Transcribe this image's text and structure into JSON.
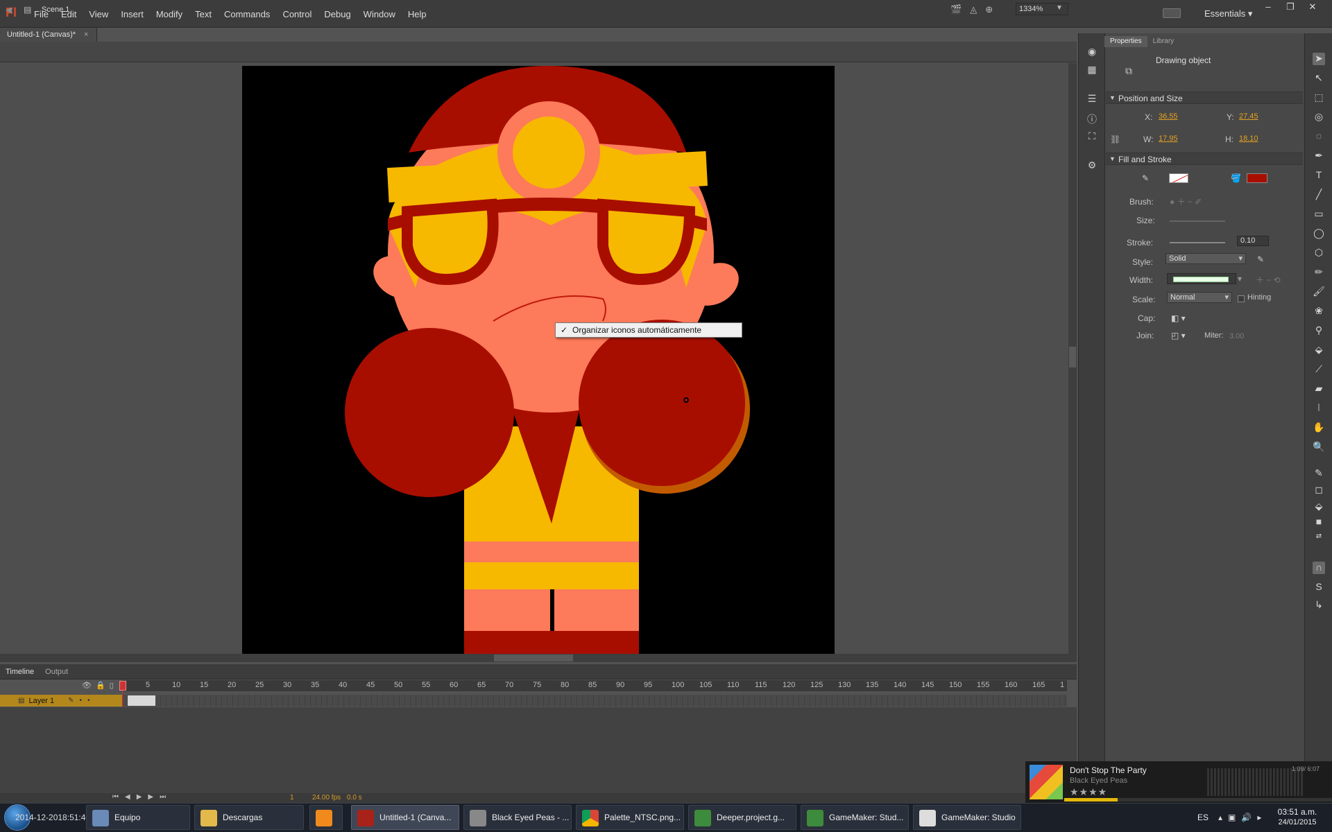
{
  "app": {
    "logo": "Fl",
    "workspace": "Essentials"
  },
  "menubar": {
    "items": [
      "File",
      "Edit",
      "View",
      "Insert",
      "Modify",
      "Text",
      "Commands",
      "Control",
      "Debug",
      "Window",
      "Help"
    ]
  },
  "window_controls": {
    "minimize": "–",
    "restore": "❐",
    "close": "✕"
  },
  "document": {
    "tab_title": "Untitled-1 (Canvas)*",
    "close": "×"
  },
  "edit_bar": {
    "scene": "Scene 1",
    "zoom": "1334%"
  },
  "context_menu": {
    "check": "✓",
    "item": "Organizar iconos automáticamente",
    "checked": true
  },
  "timeline": {
    "tabs": [
      "Timeline",
      "Output"
    ],
    "active_tab": "Timeline",
    "ruler": [
      "5",
      "10",
      "15",
      "20",
      "25",
      "30",
      "35",
      "40",
      "45",
      "50",
      "55",
      "60",
      "65",
      "70",
      "75",
      "80",
      "85",
      "90",
      "95",
      "100",
      "105",
      "110",
      "115",
      "120",
      "125",
      "130",
      "135",
      "140",
      "145",
      "150",
      "155",
      "160",
      "165",
      "1"
    ],
    "layer_name": "Layer 1",
    "current_frame": "1",
    "fps": "24.00 fps",
    "time": "0.0 s"
  },
  "properties": {
    "tabs": [
      "Properties",
      "Library"
    ],
    "active_tab": "Properties",
    "object_type": "Drawing object",
    "position_section": "Position and Size",
    "x_label": "X:",
    "x": "36.55",
    "y_label": "Y:",
    "y": "27.45",
    "w_label": "W:",
    "w": "17.95",
    "h_label": "H:",
    "h": "18.10",
    "fill_section": "Fill and Stroke",
    "fill_color": "#a80e00",
    "brush_label": "Brush:",
    "size_label": "Size:",
    "stroke_label": "Stroke:",
    "stroke": "0.10",
    "style_label": "Style:",
    "style": "Solid",
    "width_label": "Width:",
    "scale_label": "Scale:",
    "scale": "Normal",
    "hinting_label": "Hinting",
    "cap_label": "Cap:",
    "join_label": "Join:",
    "miter_label": "Miter:",
    "miter": "3.00"
  },
  "music": {
    "title": "Don't Stop The Party",
    "artist": "Black Eyed Peas",
    "stars": "★★★★",
    "time": "1:09/ 6:07",
    "progress": 0.2
  },
  "taskbar": {
    "start_tip": "2014-12-2018:51:40.ip",
    "tasks": [
      "Equipo",
      "Descargas",
      "",
      "Untitled-1 (Canva...",
      "Black Eyed Peas - ...",
      "Palette_NTSC.png...",
      "Deeper.project.g...",
      "GameMaker: Stud...",
      "GameMaker: Studio"
    ],
    "lang": "ES",
    "time": "03:51 a.m.",
    "date": "24/01/2015"
  },
  "colors": {
    "stage_bg": "#000000",
    "skin": "#fd7a5a",
    "red": "#a80e00",
    "yellow": "#f7b800",
    "layer_highlight": "#b3871c",
    "accent_value": "#e7a21e"
  }
}
